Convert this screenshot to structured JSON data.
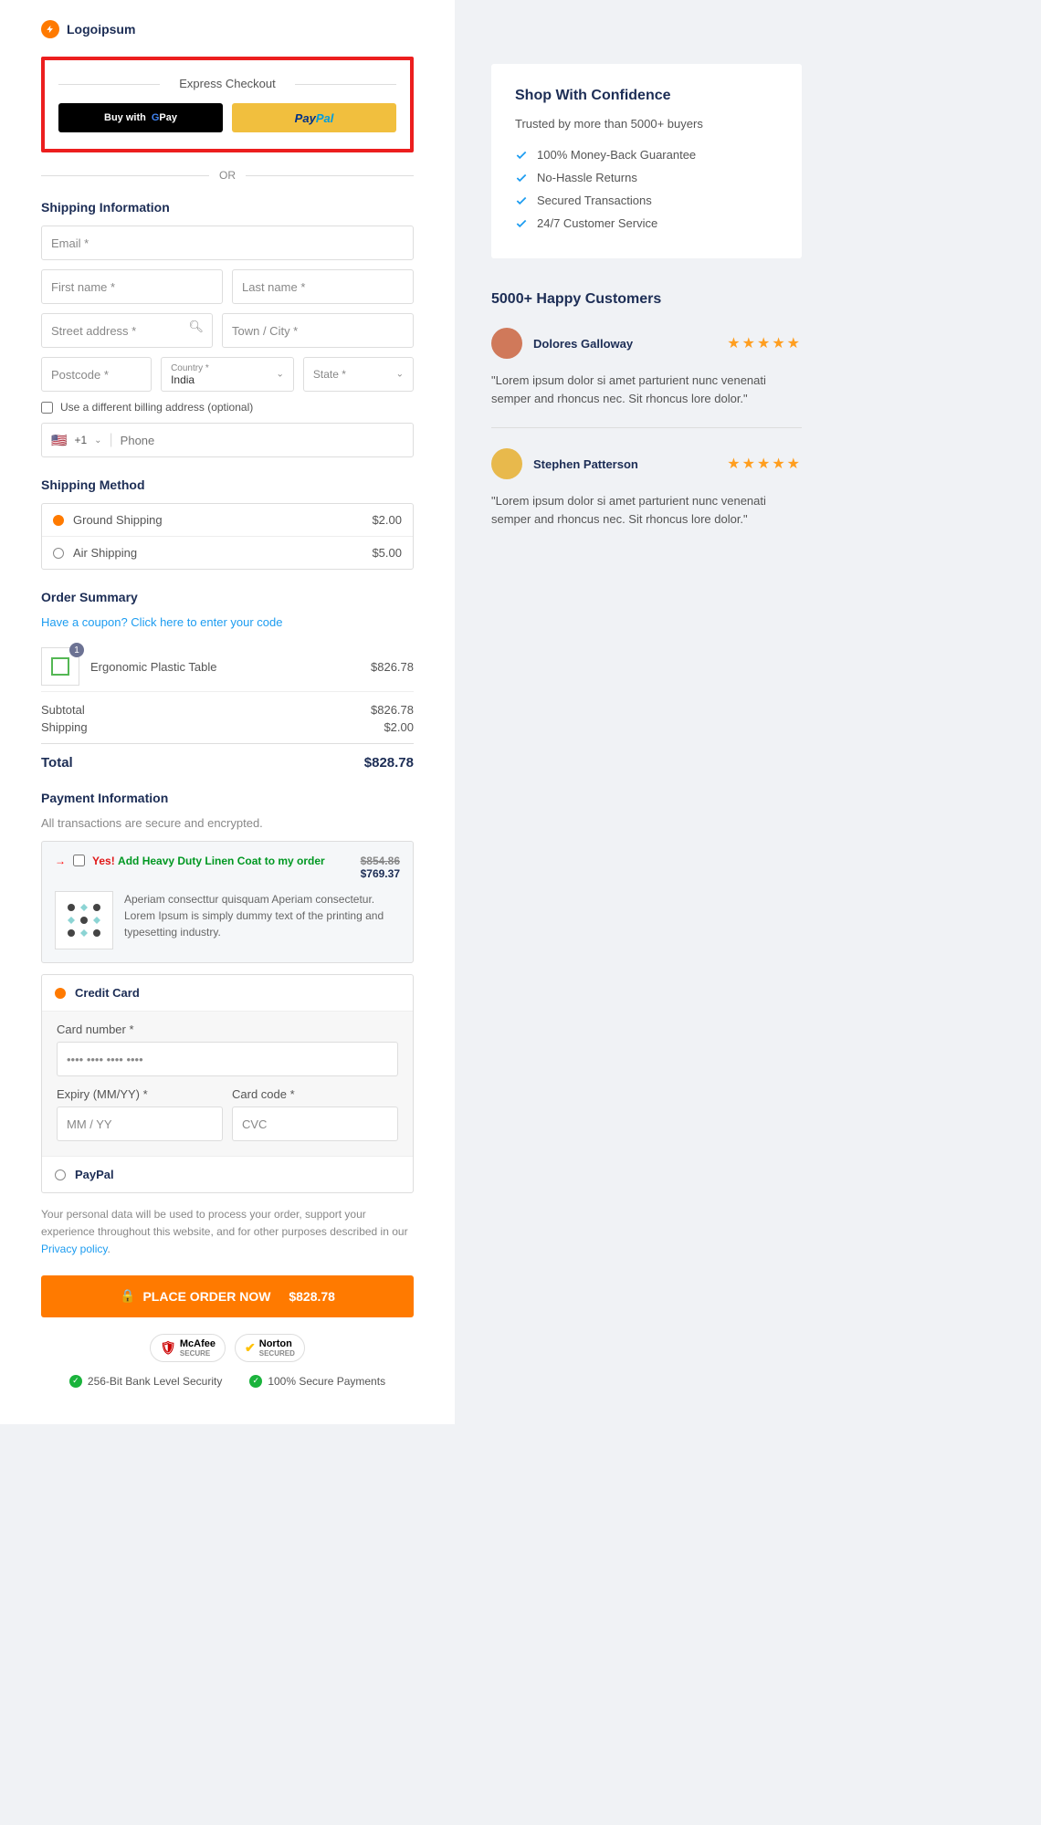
{
  "logo": "Logoipsum",
  "express": {
    "hdr": "Express Checkout",
    "gpay_pre": "Buy with",
    "gpay_g": "G",
    "gpay_txt": "Pay",
    "paypal1": "Pay",
    "paypal2": "Pal",
    "or": "OR"
  },
  "ship": {
    "hdr": "Shipping Information",
    "email": "Email *",
    "fn": "First name *",
    "ln": "Last name *",
    "addr": "Street address *",
    "city": "Town / City *",
    "pc": "Postcode *",
    "country_lbl": "Country *",
    "country_val": "India",
    "state": "State *",
    "bill_chk": "Use a different billing address (optional)",
    "dial": "+1",
    "phone": "Phone"
  },
  "method": {
    "hdr": "Shipping Method",
    "ground": "Ground Shipping",
    "gprice": "$2.00",
    "air": "Air Shipping",
    "aprice": "$5.00"
  },
  "order": {
    "hdr": "Order Summary",
    "coupon": "Have a coupon? Click here to enter your code",
    "qty": "1",
    "item": "Ergonomic Plastic Table",
    "price": "$826.78",
    "sub_l": "Subtotal",
    "sub_v": "$826.78",
    "ship_l": "Shipping",
    "ship_v": "$2.00",
    "tot_l": "Total",
    "tot_v": "$828.78"
  },
  "pay": {
    "hdr": "Payment Information",
    "sub": "All transactions are secure and encrypted.",
    "yes": "Yes!",
    "add": "Add Heavy Duty Linen Coat to my order",
    "old": "$854.86",
    "new": "$769.37",
    "desc": "Aperiam consecttur quisquam Aperiam consectetur. Lorem Ipsum is simply dummy text of the printing and typesetting industry.",
    "cc": "Credit Card",
    "cnum": "Card number *",
    "cnum_ph": "•••• •••• •••• ••••",
    "exp": "Expiry (MM/YY) *",
    "exp_ph": "MM / YY",
    "cvc_l": "Card code *",
    "cvc_ph": "CVC",
    "pp": "PayPal"
  },
  "priv": {
    "txt1": "Your personal data will be used to process your order, support your experience throughout this website, and for other purposes described in our ",
    "link": "Privacy policy",
    "txt2": "."
  },
  "btn": {
    "txt": "PLACE ORDER NOW",
    "amt": "$828.78"
  },
  "secbadges": {
    "b1a": "McAfee",
    "b1b": "SECURE",
    "b2a": "Norton",
    "b2b": "SECURED",
    "s1": "256-Bit Bank Level Security",
    "s2": "100% Secure Payments"
  },
  "side": {
    "hdr": "Shop With Confidence",
    "sub": "Trusted by more than 5000+ buyers",
    "items": [
      "100% Money-Back Guarantee",
      "No-Hassle Returns",
      "Secured Transactions",
      "24/7 Customer Service"
    ]
  },
  "rev": {
    "hdr": "5000+ Happy Customers",
    "items": [
      {
        "name": "Dolores Galloway",
        "txt": "\"Lorem ipsum dolor si amet parturient nunc venenati semper and rhoncus nec. Sit rhoncus lore dolor.\"",
        "av": "#d0795a"
      },
      {
        "name": "Stephen Patterson",
        "txt": "\"Lorem ipsum dolor si amet parturient nunc venenati semper and rhoncus nec. Sit rhoncus lore dolor.\"",
        "av": "#e8b94c"
      }
    ]
  }
}
